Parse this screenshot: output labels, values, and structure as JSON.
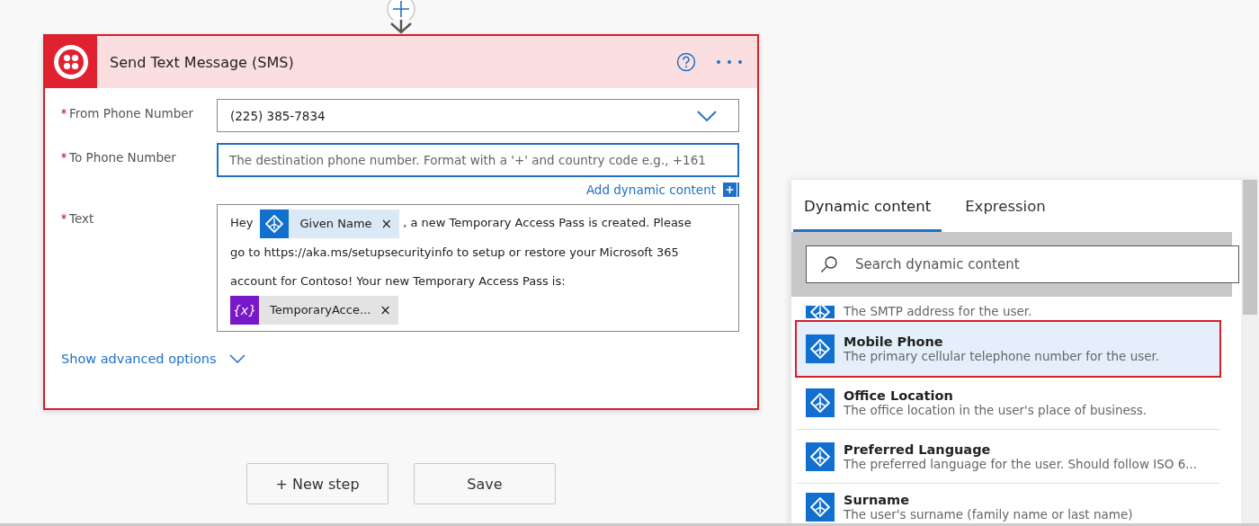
{
  "action": {
    "title": "Send Text Message (SMS)",
    "fields": [
      {
        "label": "From Phone Number",
        "required": true,
        "kind": "dropdown",
        "value": "(225) 385-7834",
        "focused": false
      },
      {
        "label": "To Phone Number",
        "required": true,
        "kind": "input",
        "placeholder": "The destination phone number. Format with a '+' and country code e.g., +161",
        "focused": true,
        "link": "Add dynamic content"
      },
      {
        "label": "Text",
        "required": true,
        "kind": "rich",
        "focused": false,
        "segments": [
          {
            "kind": "text",
            "text": "Hey"
          },
          {
            "kind": "user",
            "label": "Given Name",
            "remove": "×"
          },
          {
            "kind": "text",
            "text": ", a new Temporary Access Pass is created. Please"
          },
          {
            "kind": "text",
            "text": "go to https://aka.ms/setupsecurityinfo to setup or restore your Microsoft 365"
          },
          {
            "kind": "text",
            "text": "account for Contoso! Your new Temporary Access Pass is:"
          },
          {
            "kind": "variable",
            "badge": "{x}",
            "label": "TemporaryAcce...",
            "remove": "×"
          }
        ]
      }
    ],
    "advanced": "Show advanced options"
  },
  "buttons": [
    "+ New step",
    "Save"
  ],
  "panel": {
    "tabs": [
      {
        "label": "Dynamic content",
        "selected": true
      },
      {
        "label": "Expression",
        "selected": false
      }
    ],
    "search": {
      "placeholder": "Search dynamic content"
    },
    "items": [
      {
        "description": "The SMTP address for the user.",
        "selected": false
      },
      {
        "title": "Mobile Phone",
        "description": "The primary cellular telephone number for the user.",
        "selected": true
      },
      {
        "title": "Office Location",
        "description": "The office location in the user's place of business.",
        "selected": false
      },
      {
        "title": "Preferred Language",
        "description": "The preferred language for the user. Should follow ISO 6...",
        "selected": false
      },
      {
        "title": "Surname",
        "description": "The user's surname (family name or last name)",
        "selected": false
      }
    ]
  }
}
